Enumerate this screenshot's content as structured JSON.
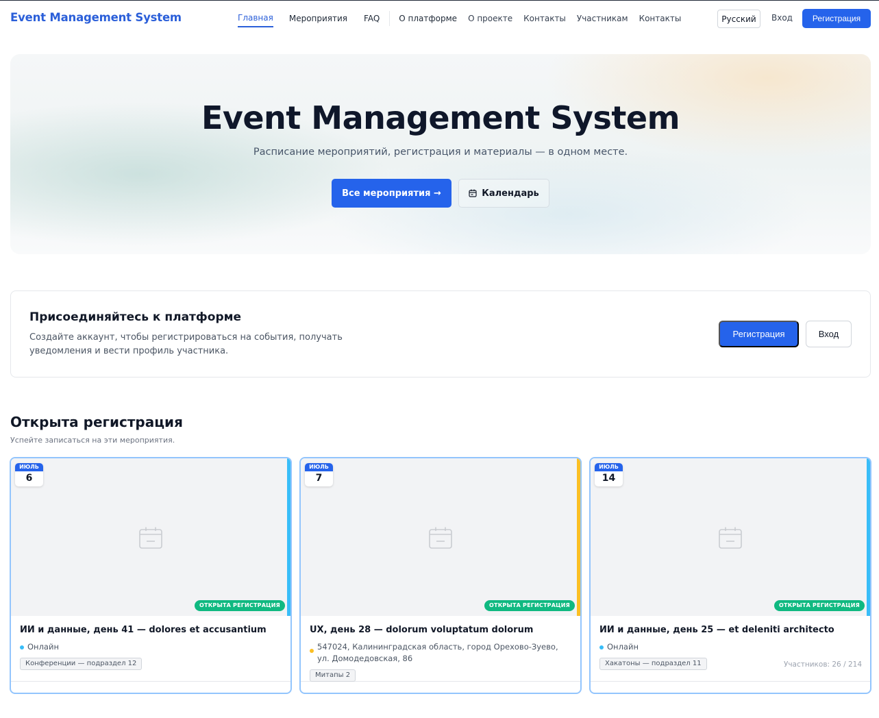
{
  "header": {
    "brand": "Event Management System",
    "nav": [
      "Главная",
      "Мероприятия",
      "FAQ",
      "О платформе",
      "О проекте",
      "Контакты",
      "Участникам",
      "Контакты"
    ],
    "language": "Русский",
    "login": "Вход",
    "register": "Регистрация"
  },
  "hero": {
    "title": "Event Management System",
    "subtitle": "Расписание мероприятий, регистрация и материалы — в одном месте.",
    "primary_button": "Все мероприятия →",
    "secondary_button": "Календарь",
    "secondary_icon": "calendar-icon"
  },
  "join": {
    "title": "Присоединяйтесь к платформе",
    "text": "Создайте аккаунт, чтобы регистрироваться на события, получать уведомления и вести профиль участника.",
    "register": "Регистрация",
    "login": "Вход"
  },
  "section": {
    "title": "Открыта регистрация",
    "subtitle": "Успейте записаться на эти мероприятия."
  },
  "cards": [
    {
      "month": "ИЮЛЬ",
      "day": "6",
      "status": "ОТКРЫТА РЕГИСТРАЦИЯ",
      "title": "ИИ и данные, день 41 — dolores et accusantium",
      "location": "Онлайн",
      "tag": "Конференции — подраздел 12",
      "participants": "",
      "accent": "#38bdf8",
      "dot_color": "#38bdf8"
    },
    {
      "month": "ИЮЛЬ",
      "day": "7",
      "status": "ОТКРЫТА РЕГИСТРАЦИЯ",
      "title": "UX, день 28 — dolorum voluptatum dolorum",
      "location": "547024, Калининградская область, город Орехово-Зуево, ул. Домодедовская, 86",
      "tag": "Митапы 2",
      "participants": "",
      "accent": "#fbbf24",
      "dot_color": "#fbbf24"
    },
    {
      "month": "ИЮЛЬ",
      "day": "14",
      "status": "ОТКРЫТА РЕГИСТРАЦИЯ",
      "title": "ИИ и данные, день 25 — et deleniti architecto",
      "location": "Онлайн",
      "tag": "Хакатоны — подраздел 11",
      "participants": "Участников: 26 / 214",
      "accent": "#38bdf8",
      "dot_color": "#38bdf8"
    }
  ],
  "colors": {
    "primary": "#2563eb",
    "brand": "#2b5fd9",
    "status_green": "#10b981"
  }
}
